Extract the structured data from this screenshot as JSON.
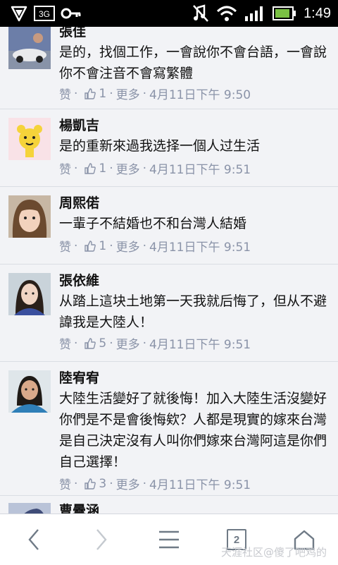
{
  "status_bar": {
    "time": "1:49"
  },
  "comments": [
    {
      "name": "張佳",
      "text": "是的，找個工作，一會說你不會台語，一會說你不會注音不會寫繁體",
      "like_label": "赞",
      "likes": "1",
      "more_label": "更多",
      "timestamp": "4月11日下午 9:50"
    },
    {
      "name": "楊凱吉",
      "text": "是的重新來過我选择一個人过生活",
      "like_label": "赞",
      "likes": "1",
      "more_label": "更多",
      "timestamp": "4月11日下午 9:51"
    },
    {
      "name": "周熙偌",
      "text": "一輩子不結婚也不和台灣人結婚",
      "like_label": "赞",
      "likes": "1",
      "more_label": "更多",
      "timestamp": "4月11日下午 9:51"
    },
    {
      "name": "張依維",
      "text": "从踏上這块土地第一天我就后悔了，但从不避諱我是大陸人！",
      "like_label": "赞",
      "likes": "5",
      "more_label": "更多",
      "timestamp": "4月11日下午 9:51"
    },
    {
      "name": "陸宥宥",
      "text": "大陸生活變好了就後悔！加入大陸生活沒變好你們是不是會後悔欸？人都是現實的嫁來台灣是自己決定沒有人叫你們嫁來台灣阿這是你們自己選擇！",
      "like_label": "赞",
      "likes": "3",
      "more_label": "更多",
      "timestamp": "4月11日下午 9:51"
    },
    {
      "name": "曹曇涵"
    }
  ],
  "meta_separator": "·",
  "bottom_bar": {
    "tab_count": "2"
  },
  "watermark": "天涯社区@傻了吧鸡的"
}
